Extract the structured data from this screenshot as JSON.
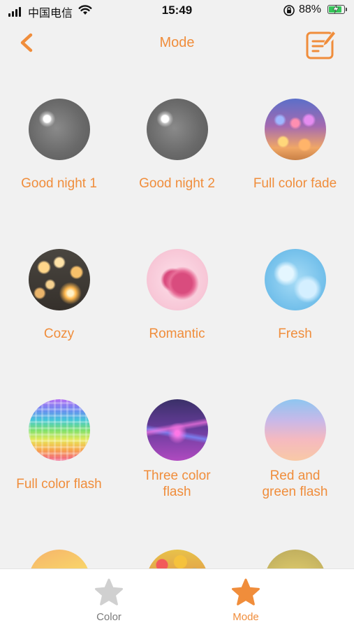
{
  "status_bar": {
    "carrier": "中国电信",
    "time": "15:49",
    "battery_percent": "88%",
    "battery_level": 0.88,
    "icons": [
      "signal-icon",
      "wifi-icon",
      "orientation-lock-icon",
      "battery-charging-icon"
    ]
  },
  "nav": {
    "title": "Mode",
    "back_icon": "chevron-left-icon",
    "edit_icon": "edit-note-icon"
  },
  "modes": [
    {
      "label": "Good night 1",
      "theme": "moon-night"
    },
    {
      "label": "Good night 2",
      "theme": "moon-night"
    },
    {
      "label": "Full color fade",
      "theme": "bokeh-sunset"
    },
    {
      "label": "Cozy",
      "theme": "candle-bokeh"
    },
    {
      "label": "Romantic",
      "theme": "pink-heart"
    },
    {
      "label": "Fresh",
      "theme": "blue-water"
    },
    {
      "label": "Full color flash",
      "theme": "rainbow-pixels"
    },
    {
      "label": "Three color flash",
      "theme": "neon-waves"
    },
    {
      "label": "Red and green flash",
      "theme": "pastel-gradient"
    },
    {
      "label": "",
      "theme": "warm-gradient"
    },
    {
      "label": "",
      "theme": "color-dots"
    },
    {
      "label": "",
      "theme": "gold-glow"
    }
  ],
  "tabs": [
    {
      "label": "Color",
      "icon": "star-icon",
      "active": false
    },
    {
      "label": "Mode",
      "icon": "star-icon",
      "active": true
    }
  ],
  "colors": {
    "accent": "#f08d3b",
    "background": "#f1f1f1",
    "tab_inactive": "#d0d0d0",
    "tab_label_inactive": "#7a7a7a"
  }
}
